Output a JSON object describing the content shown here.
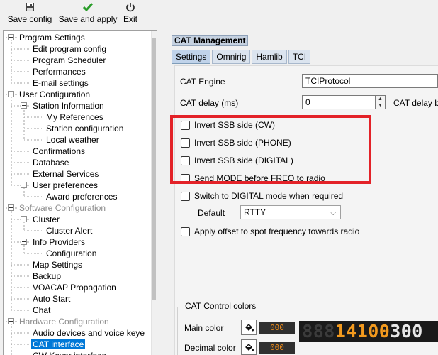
{
  "toolbar": {
    "save_config": "Save config",
    "save_and_apply": "Save and apply",
    "exit": "Exit"
  },
  "tree": [
    {
      "label": "Program Settings",
      "level": 0,
      "expanded": true,
      "disabled": false
    },
    {
      "label": "Edit program config",
      "level": 1
    },
    {
      "label": "Program Scheduler",
      "level": 1
    },
    {
      "label": "Performances",
      "level": 1
    },
    {
      "label": "E-mail settings",
      "level": 1
    },
    {
      "label": "User Configuration",
      "level": 0,
      "expanded": true,
      "disabled": false
    },
    {
      "label": "Station Information",
      "level": 1,
      "expanded": true
    },
    {
      "label": "My References",
      "level": 2
    },
    {
      "label": "Station configuration",
      "level": 2
    },
    {
      "label": "Local weather",
      "level": 2
    },
    {
      "label": "Confirmations",
      "level": 1
    },
    {
      "label": "Database",
      "level": 1
    },
    {
      "label": "External Services",
      "level": 1
    },
    {
      "label": "User preferences",
      "level": 1,
      "expanded": true
    },
    {
      "label": "Award preferences",
      "level": 2
    },
    {
      "label": "Software Configuration",
      "level": 0,
      "expanded": true,
      "disabled": true
    },
    {
      "label": "Cluster",
      "level": 1,
      "expanded": true
    },
    {
      "label": "Cluster Alert",
      "level": 2
    },
    {
      "label": "Info Providers",
      "level": 1,
      "expanded": true
    },
    {
      "label": "Configuration",
      "level": 2
    },
    {
      "label": "Map Settings",
      "level": 1
    },
    {
      "label": "Backup",
      "level": 1
    },
    {
      "label": "VOACAP Propagation",
      "level": 1
    },
    {
      "label": "Auto Start",
      "level": 1
    },
    {
      "label": "Chat",
      "level": 1
    },
    {
      "label": "Hardware Configuration",
      "level": 0,
      "expanded": true,
      "disabled": true
    },
    {
      "label": "Audio devices and voice keye",
      "level": 1
    },
    {
      "label": "CAT interface",
      "level": 1,
      "selected": true
    },
    {
      "label": "CW Keyer interface",
      "level": 1
    }
  ],
  "panel": {
    "title": "CAT Management",
    "tabs": [
      "Settings",
      "Omnirig",
      "Hamlib",
      "TCI"
    ],
    "active_tab": "Settings",
    "cat_engine_label": "CAT Engine",
    "cat_engine_value": "TCIProtocol",
    "cat_delay_label": "CAT delay (ms)",
    "cat_delay_value": "0",
    "cat_delay_b_label": "CAT delay b",
    "checkboxes": [
      {
        "label": "Invert SSB side (CW)",
        "checked": false
      },
      {
        "label": "Invert SSB side (PHONE)",
        "checked": false
      },
      {
        "label": "Invert SSB side (DIGITAL)",
        "checked": false
      },
      {
        "label": "Send MODE before FREQ to radio",
        "checked": false
      },
      {
        "label": "Switch to DIGITAL mode when required",
        "checked": false
      }
    ],
    "default_label": "Default",
    "default_value": "RTTY",
    "apply_offset_label": "Apply offset to spot frequency towards radio",
    "colors": {
      "group_title": "CAT Control colors",
      "main_label": "Main color",
      "main_value": "000",
      "decimal_label": "Decimal color",
      "decimal_value": "000"
    },
    "display": "88814100300"
  },
  "highlight_color": "#e32228"
}
